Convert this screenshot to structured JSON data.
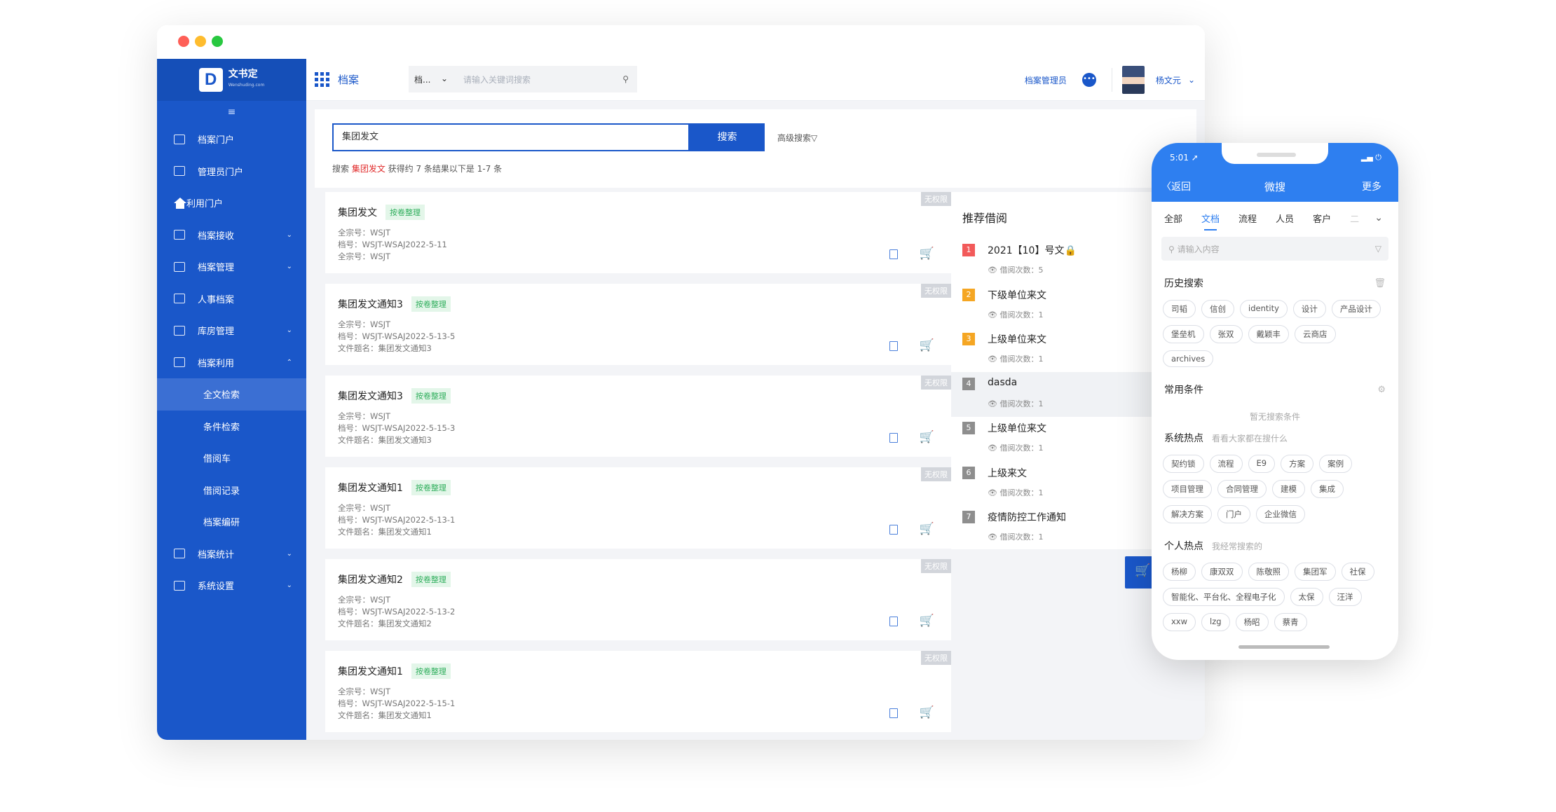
{
  "window": {
    "dots": [
      "#fe5f57",
      "#febc2e",
      "#28c840"
    ]
  },
  "logo": {
    "mark": "D",
    "name": "文书定",
    "sub": "Wenshuding.com"
  },
  "sidebar": {
    "collapse_icon": "≡",
    "items": [
      {
        "label": "档案门户",
        "icon": "monitor-icon",
        "chevron": ""
      },
      {
        "label": "管理员门户",
        "icon": "doc-icon",
        "chevron": ""
      },
      {
        "label": "利用门户",
        "icon": "home-icon",
        "chevron": ""
      },
      {
        "label": "档案接收",
        "icon": "doc-icon",
        "chevron": "⌄"
      },
      {
        "label": "档案管理",
        "icon": "doc-icon",
        "chevron": "⌄"
      },
      {
        "label": "人事档案",
        "icon": "doc-icon",
        "chevron": ""
      },
      {
        "label": "库房管理",
        "icon": "doc-icon",
        "chevron": "⌄"
      },
      {
        "label": "档案利用",
        "icon": "doc-icon",
        "chevron": "⌃"
      },
      {
        "label": "全文检索",
        "sub": true,
        "active": true
      },
      {
        "label": "条件检索",
        "sub": true
      },
      {
        "label": "借阅车",
        "sub": true
      },
      {
        "label": "借阅记录",
        "sub": true
      },
      {
        "label": "档案编研",
        "sub": true
      },
      {
        "label": "档案统计",
        "icon": "doc-icon",
        "chevron": "⌄"
      },
      {
        "label": "系统设置",
        "icon": "doc-icon",
        "chevron": "⌄"
      }
    ]
  },
  "topbar": {
    "title": "档案",
    "select": "档...",
    "select_arrow": "⌄",
    "placeholder": "请输入关键词搜索",
    "search_icon": "⚲",
    "role": "档案管理员",
    "more": "•••",
    "user": "杨文元",
    "user_arrow": "⌄"
  },
  "search": {
    "value": "集团发文",
    "button": "搜索",
    "advanced": "高级搜索▽",
    "stat_prefix": "搜索 ",
    "stat_keyword": "集团发文",
    "stat_suffix": " 获得约 7 条结果以下是 1-7 条"
  },
  "results": [
    {
      "title": "集团发文",
      "tag": "按卷整理",
      "badge": "无权限",
      "l1": "全宗号：WSJT",
      "l2": "档号：WSJT-WSAJ2022-5-11",
      "l3": "全宗号：WSJT"
    },
    {
      "title": "集团发文通知3",
      "tag": "按卷整理",
      "badge": "无权限",
      "l1": "全宗号：WSJT",
      "l2": "档号：WSJT-WSAJ2022-5-13-5",
      "l3": "文件题名：集团发文通知3"
    },
    {
      "title": "集团发文通知3",
      "tag": "按卷整理",
      "badge": "无权限",
      "l1": "全宗号：WSJT",
      "l2": "档号：WSJT-WSAJ2022-5-15-3",
      "l3": "文件题名：集团发文通知3"
    },
    {
      "title": "集团发文通知1",
      "tag": "按卷整理",
      "badge": "无权限",
      "l1": "全宗号：WSJT",
      "l2": "档号：WSJT-WSAJ2022-5-13-1",
      "l3": "文件题名：集团发文通知1"
    },
    {
      "title": "集团发文通知2",
      "tag": "按卷整理",
      "badge": "无权限",
      "l1": "全宗号：WSJT",
      "l2": "档号：WSJT-WSAJ2022-5-13-2",
      "l3": "文件题名：集团发文通知2"
    },
    {
      "title": "集团发文通知1",
      "tag": "按卷整理",
      "badge": "无权限",
      "l1": "全宗号：WSJT",
      "l2": "档号：WSJT-WSAJ2022-5-15-1",
      "l3": "文件题名：集团发文通知1"
    }
  ],
  "recommend": {
    "title": "推荐借阅",
    "items": [
      {
        "n": "1",
        "name": "2021【10】号文🔒",
        "count": "👁 借阅次数：5",
        "color": "#f25a5a"
      },
      {
        "n": "2",
        "name": "下级单位来文",
        "count": "👁 借阅次数：1",
        "color": "#f5a623"
      },
      {
        "n": "3",
        "name": "上级单位来文",
        "count": "👁 借阅次数：1",
        "color": "#f5a623"
      },
      {
        "n": "4",
        "name": "dasda",
        "count": "👁 借阅次数：1",
        "color": "#8e8e8e",
        "hl": true
      },
      {
        "n": "5",
        "name": "上级单位来文",
        "count": "👁 借阅次数：1",
        "color": "#8e8e8e"
      },
      {
        "n": "6",
        "name": "上级来文",
        "count": "👁 借阅次数：1",
        "color": "#8e8e8e"
      },
      {
        "n": "7",
        "name": "疫情防控工作通知",
        "count": "👁 借阅次数：1",
        "color": "#8e8e8e"
      }
    ]
  },
  "fab": {
    "icon": "🛒"
  },
  "phone": {
    "time": "5:01 ➚",
    "battery": "▂▄ ⏻",
    "back": "〈返回",
    "title": "微搜",
    "more": "更多",
    "tabs": [
      "全部",
      "文档",
      "流程",
      "人员",
      "客户",
      "二"
    ],
    "tabs_arrow": "⌄",
    "search_placeholder": "⚲ 请输入内容",
    "filter_icon": "▽",
    "history_title": "历史搜索",
    "trash_icon": "🗑",
    "history": [
      "司韬",
      "信创",
      "identity",
      "设计",
      "产品设计",
      "堡垒机",
      "张双",
      "戴颖丰",
      "云商店",
      "archives"
    ],
    "common_title": "常用条件",
    "gear_icon": "⚙",
    "common_empty": "暂无搜索条件",
    "hot_title": "系统热点",
    "hot_sub": "看看大家都在搜什么",
    "hot": [
      "契约锁",
      "流程",
      "E9",
      "方案",
      "案例",
      "项目管理",
      "合同管理",
      "建模",
      "集成",
      "解决方案",
      "门户",
      "企业微信"
    ],
    "personal_title": "个人热点",
    "personal_sub": "我经常搜索的",
    "personal": [
      "杨柳",
      "康双双",
      "陈敬照",
      "集团军",
      "社保",
      "智能化、平台化、全程电子化",
      "太保",
      "汪洋",
      "xxw",
      "lzg",
      "杨昭",
      "蔡青"
    ]
  }
}
